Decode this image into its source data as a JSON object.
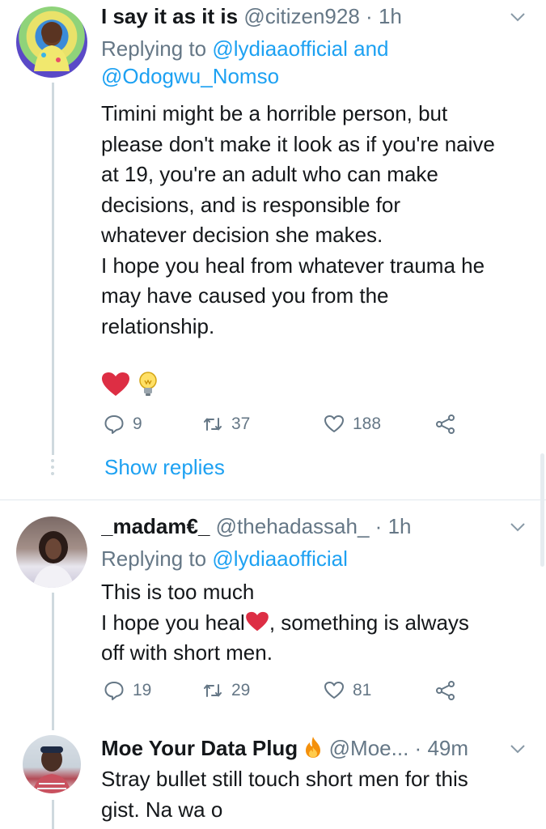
{
  "tweets": [
    {
      "name": "I say it as it is",
      "handle": "@citizen928",
      "time_sep": "·",
      "time": "1h",
      "replying_label": "Replying to",
      "mentions": [
        "@lydiaaofficial",
        "and",
        "@Odogwu_Nomso"
      ],
      "body_lines": [
        "Timini might be a horrible person, but",
        "please don't make it look as if you're naive",
        "at 19, you're an adult who can make",
        "decisions, and is responsible for",
        "whatever decision she makes.",
        "I hope you heal from whatever trauma he",
        "may have caused you from the",
        "relationship."
      ],
      "emojis": [
        "heart-emoji",
        "lightbulb-emoji"
      ],
      "reply_count": "9",
      "retweet_count": "37",
      "like_count": "188",
      "show_replies": "Show replies"
    },
    {
      "name": "_madam€_",
      "handle": "@thehadassah_",
      "time_sep": "·",
      "time": "1h",
      "replying_label": "Replying to",
      "mentions": [
        "@lydiaaofficial"
      ],
      "body_lines": [
        "This is too much",
        "I hope you heal",
        ", something is always",
        "off with short men."
      ],
      "reply_count": "19",
      "retweet_count": "29",
      "like_count": "81"
    },
    {
      "name": "Moe Your Data Plug",
      "handle": "@Moe...",
      "time_sep": "·",
      "time": "49m",
      "body_lines": [
        "Stray bullet still touch short men for this",
        "gist. Na wa o"
      ]
    }
  ],
  "colors": {
    "accent": "#1da1f2",
    "muted": "#657786",
    "text": "#14171a",
    "heart": "#e0245e",
    "thread_line": "#cfd9de",
    "divider": "#e1e8ed"
  }
}
